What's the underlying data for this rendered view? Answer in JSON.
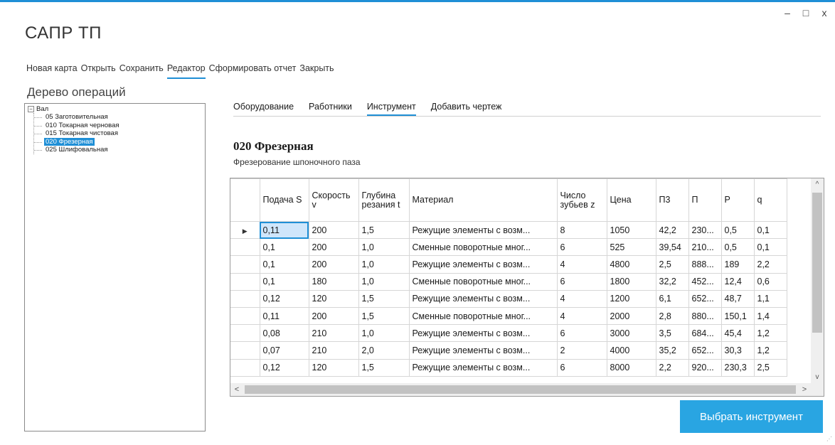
{
  "window": {
    "title": "САПР ТП",
    "controls": {
      "minimize": "–",
      "maximize": "□",
      "close": "x"
    }
  },
  "menu": [
    {
      "label": "Новая карта",
      "name": "menu-new-map"
    },
    {
      "label": "Открыть",
      "name": "menu-open"
    },
    {
      "label": "Сохранить",
      "name": "menu-save"
    },
    {
      "label": "Редактор",
      "name": "menu-editor",
      "active": true
    },
    {
      "label": "Сформировать отчет",
      "name": "menu-report"
    },
    {
      "label": "Закрыть",
      "name": "menu-close"
    }
  ],
  "tree": {
    "title": "Дерево операций",
    "root": "Вал",
    "expander": "−",
    "items": [
      {
        "label": "05 Заготовительная",
        "selected": false
      },
      {
        "label": "010 Токарная черновая",
        "selected": false
      },
      {
        "label": "015 Токарная чистовая",
        "selected": false
      },
      {
        "label": "020 Фрезерная",
        "selected": true
      },
      {
        "label": "025 Шлифовальная",
        "selected": false
      }
    ]
  },
  "tabs": [
    {
      "label": "Оборудование",
      "name": "tab-equipment"
    },
    {
      "label": "Работники",
      "name": "tab-workers"
    },
    {
      "label": "Инструмент",
      "name": "tab-tools",
      "active": true
    },
    {
      "label": "Добавить чертеж",
      "name": "tab-add-drawing"
    }
  ],
  "operation": {
    "title": "020 Фрезерная",
    "description": "Фрезерование шпоночного паза"
  },
  "table": {
    "columns": [
      "",
      "Подача S",
      "Скорость v",
      "Глубина резания t",
      "Материал",
      "Число зубьев z",
      "Цена",
      "П3",
      "П",
      "Р",
      "q"
    ],
    "widths": [
      41,
      69,
      70,
      71,
      208,
      70,
      69,
      46,
      46,
      46,
      46
    ],
    "current_row_marker": "▶",
    "rows": [
      [
        "0,11",
        "200",
        "1,5",
        "Режущие элементы с возм...",
        "8",
        "1050",
        "42,2",
        "230...",
        "0,5",
        "0,1"
      ],
      [
        "0,1",
        "200",
        "1,0",
        "Сменные поворотные мног...",
        "6",
        "525",
        "39,54",
        "210...",
        "0,5",
        "0,1"
      ],
      [
        "0,1",
        "200",
        "1,0",
        "Режущие элементы с возм...",
        "4",
        "4800",
        "2,5",
        "888...",
        "189",
        "2,2"
      ],
      [
        "0,1",
        "180",
        "1,0",
        "Сменные поворотные мног...",
        "6",
        "1800",
        "32,2",
        "452...",
        "12,4",
        "0,6"
      ],
      [
        "0,12",
        "120",
        "1,5",
        "Режущие элементы с возм...",
        "4",
        "1200",
        "6,1",
        "652...",
        "48,7",
        "1,1"
      ],
      [
        "0,11",
        "200",
        "1,5",
        "Сменные поворотные мног...",
        "4",
        "2000",
        "2,8",
        "880...",
        "150,1",
        "1,4"
      ],
      [
        "0,08",
        "210",
        "1,0",
        "Режущие элементы с возм...",
        "6",
        "3000",
        "3,5",
        "684...",
        "45,4",
        "1,2"
      ],
      [
        "0,07",
        "210",
        "2,0",
        "Режущие элементы с возм...",
        "2",
        "4000",
        "35,2",
        "652...",
        "30,3",
        "1,2"
      ],
      [
        "0,12",
        "120",
        "1,5",
        "Режущие элементы с возм...",
        "6",
        "8000",
        "2,2",
        "920...",
        "230,3",
        "2,5"
      ]
    ],
    "scroll": {
      "up": "^",
      "down": "v",
      "left": "<",
      "right": ">"
    }
  },
  "action_button": {
    "label": "Выбрать инструмент"
  },
  "icons": {
    "row-marker": "black-right-pointer",
    "tree-expander": "minus-box",
    "resize-grip": "dotted-corner"
  },
  "colors": {
    "accent": "#1f8fd6",
    "button": "#29a5e2"
  }
}
